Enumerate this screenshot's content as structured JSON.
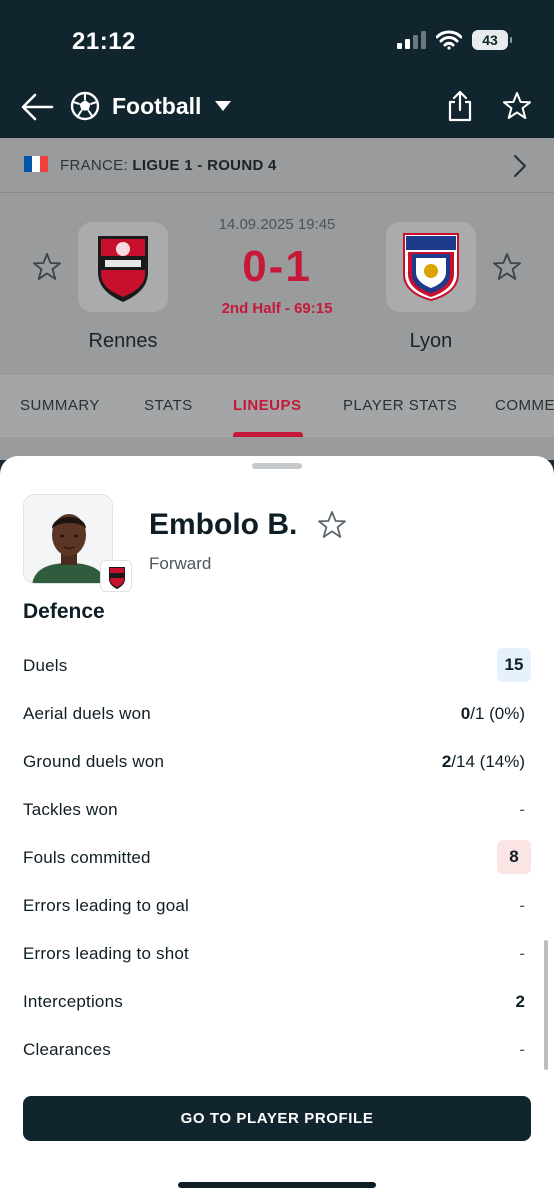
{
  "status_bar": {
    "time": "21:12",
    "battery": "43"
  },
  "app_bar": {
    "title": "Football",
    "icons": [
      "back-arrow-icon",
      "football-icon",
      "caret-down-icon",
      "share-icon",
      "star-icon"
    ]
  },
  "league": {
    "country": "FRANCE:",
    "competition": "LIGUE 1 - ROUND 4"
  },
  "match": {
    "datetime": "14.09.2025 19:45",
    "score": "0-1",
    "status": "2nd Half - 69:15",
    "home_team": "Rennes",
    "away_team": "Lyon"
  },
  "tabs": [
    {
      "label": "SUMMARY",
      "active": false
    },
    {
      "label": "STATS",
      "active": false
    },
    {
      "label": "LINEUPS",
      "active": true
    },
    {
      "label": "PLAYER STATS",
      "active": false
    },
    {
      "label": "COMME",
      "active": false
    }
  ],
  "player": {
    "name": "Embolo B.",
    "position": "Forward"
  },
  "section_title": "Defence",
  "stats": [
    {
      "label": "Duels",
      "value": "15",
      "highlight": "blue"
    },
    {
      "label": "Aerial duels won",
      "value_bold": "0",
      "value_rest": "/1 (0%)"
    },
    {
      "label": "Ground duels won",
      "value_bold": "2",
      "value_rest": "/14 (14%)"
    },
    {
      "label": "Tackles won",
      "value": "-"
    },
    {
      "label": "Fouls committed",
      "value": "8",
      "highlight": "red"
    },
    {
      "label": "Errors leading to goal",
      "value": "-"
    },
    {
      "label": "Errors leading to shot",
      "value": "-"
    },
    {
      "label": "Interceptions",
      "value": "2"
    },
    {
      "label": "Clearances",
      "value": "-"
    }
  ],
  "profile_button": "GO TO PLAYER PROFILE",
  "colors": {
    "accent": "#c7183a",
    "dark": "#10252d",
    "flag_blue": "#0055a4",
    "flag_white": "#ffffff",
    "flag_red": "#ef4135"
  }
}
